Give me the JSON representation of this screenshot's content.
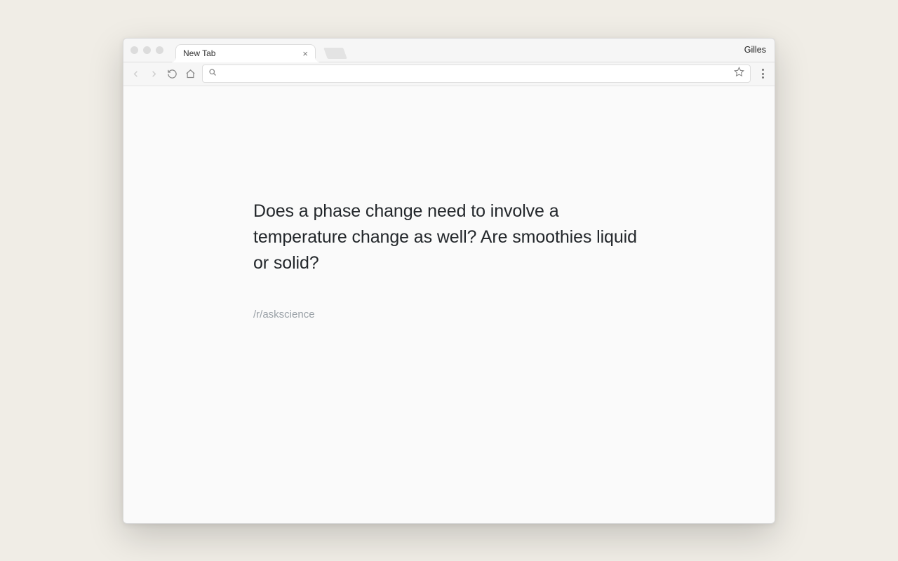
{
  "browser": {
    "tab_title": "New Tab",
    "profile_name": "Gilles",
    "omnibox_value": "",
    "omnibox_placeholder": ""
  },
  "page": {
    "headline": "Does a phase change need to involve a temperature change as well? Are smoothies liquid or solid?",
    "source": "/r/askscience"
  }
}
